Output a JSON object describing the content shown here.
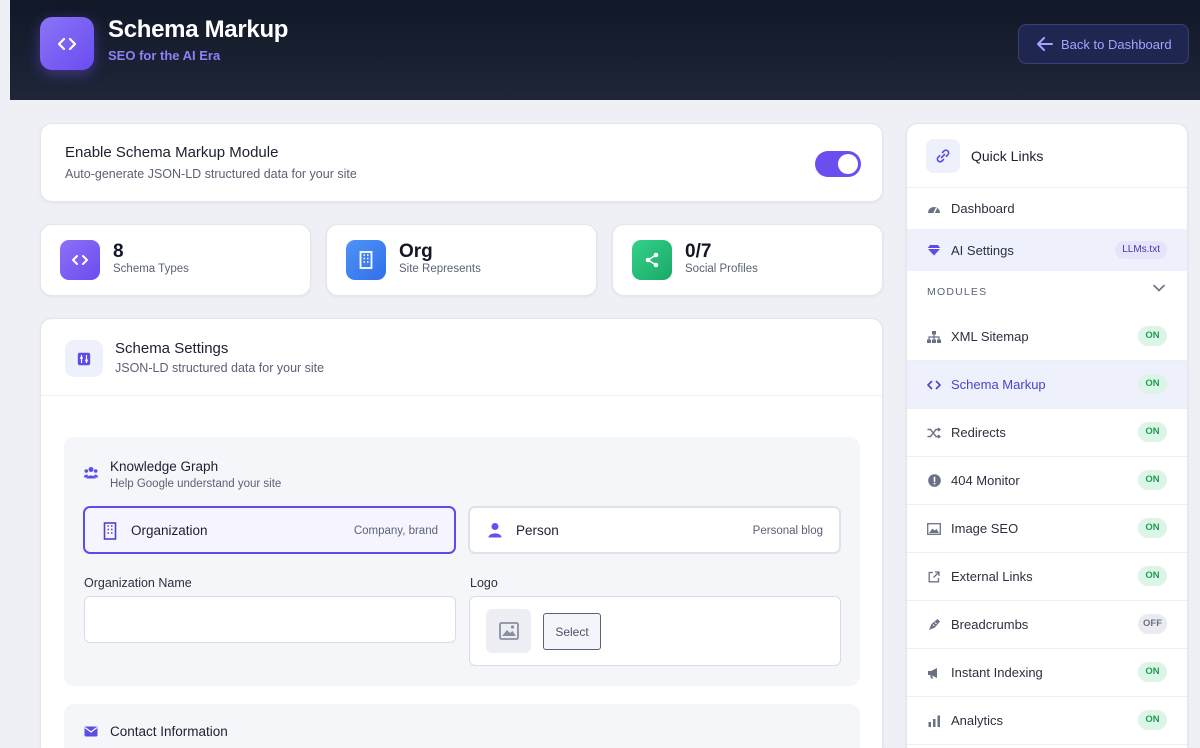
{
  "header": {
    "title": "Schema Markup",
    "subtitle": "SEO for the AI Era",
    "back_label": "Back to Dashboard"
  },
  "enable": {
    "title": "Enable Schema Markup Module",
    "subtitle": "Auto-generate JSON-LD structured data for your site",
    "enabled": true
  },
  "stats": [
    {
      "value": "8",
      "label": "Schema Types",
      "icon": "code-icon",
      "color": "#7c5cf0"
    },
    {
      "value": "Org",
      "label": "Site Represents",
      "icon": "building-icon",
      "color": "#3b82f6"
    },
    {
      "value": "0/7",
      "label": "Social Profiles",
      "icon": "share-icon",
      "color": "#22c17a"
    }
  ],
  "settings": {
    "title": "Schema Settings",
    "subtitle": "JSON-LD structured data for your site"
  },
  "knowledge_graph": {
    "title": "Knowledge Graph",
    "subtitle": "Help Google understand your site",
    "options": [
      {
        "label": "Organization",
        "hint": "Company, brand",
        "selected": true
      },
      {
        "label": "Person",
        "hint": "Personal blog",
        "selected": false
      }
    ],
    "org_name_label": "Organization Name",
    "org_name_value": "",
    "logo_label": "Logo",
    "select_label": "Select"
  },
  "contact": {
    "title": "Contact Information"
  },
  "sidebar": {
    "title": "Quick Links",
    "links": [
      {
        "label": "Dashboard",
        "icon": "gauge-icon"
      },
      {
        "label": "AI Settings",
        "icon": "gem-icon",
        "badge": "LLMs.txt"
      }
    ],
    "modules_label": "MODULES",
    "modules": [
      {
        "label": "XML Sitemap",
        "status": "ON",
        "icon": "sitemap-icon"
      },
      {
        "label": "Schema Markup",
        "status": "ON",
        "icon": "code-icon"
      },
      {
        "label": "Redirects",
        "status": "ON",
        "icon": "shuffle-icon"
      },
      {
        "label": "404 Monitor",
        "status": "ON",
        "icon": "alert-icon"
      },
      {
        "label": "Image SEO",
        "status": "ON",
        "icon": "image-icon"
      },
      {
        "label": "External Links",
        "status": "ON",
        "icon": "external-link-icon"
      },
      {
        "label": "Breadcrumbs",
        "status": "OFF",
        "icon": "bread-icon"
      },
      {
        "label": "Instant Indexing",
        "status": "ON",
        "icon": "megaphone-icon"
      },
      {
        "label": "Analytics",
        "status": "ON",
        "icon": "bar-chart-icon"
      }
    ]
  }
}
